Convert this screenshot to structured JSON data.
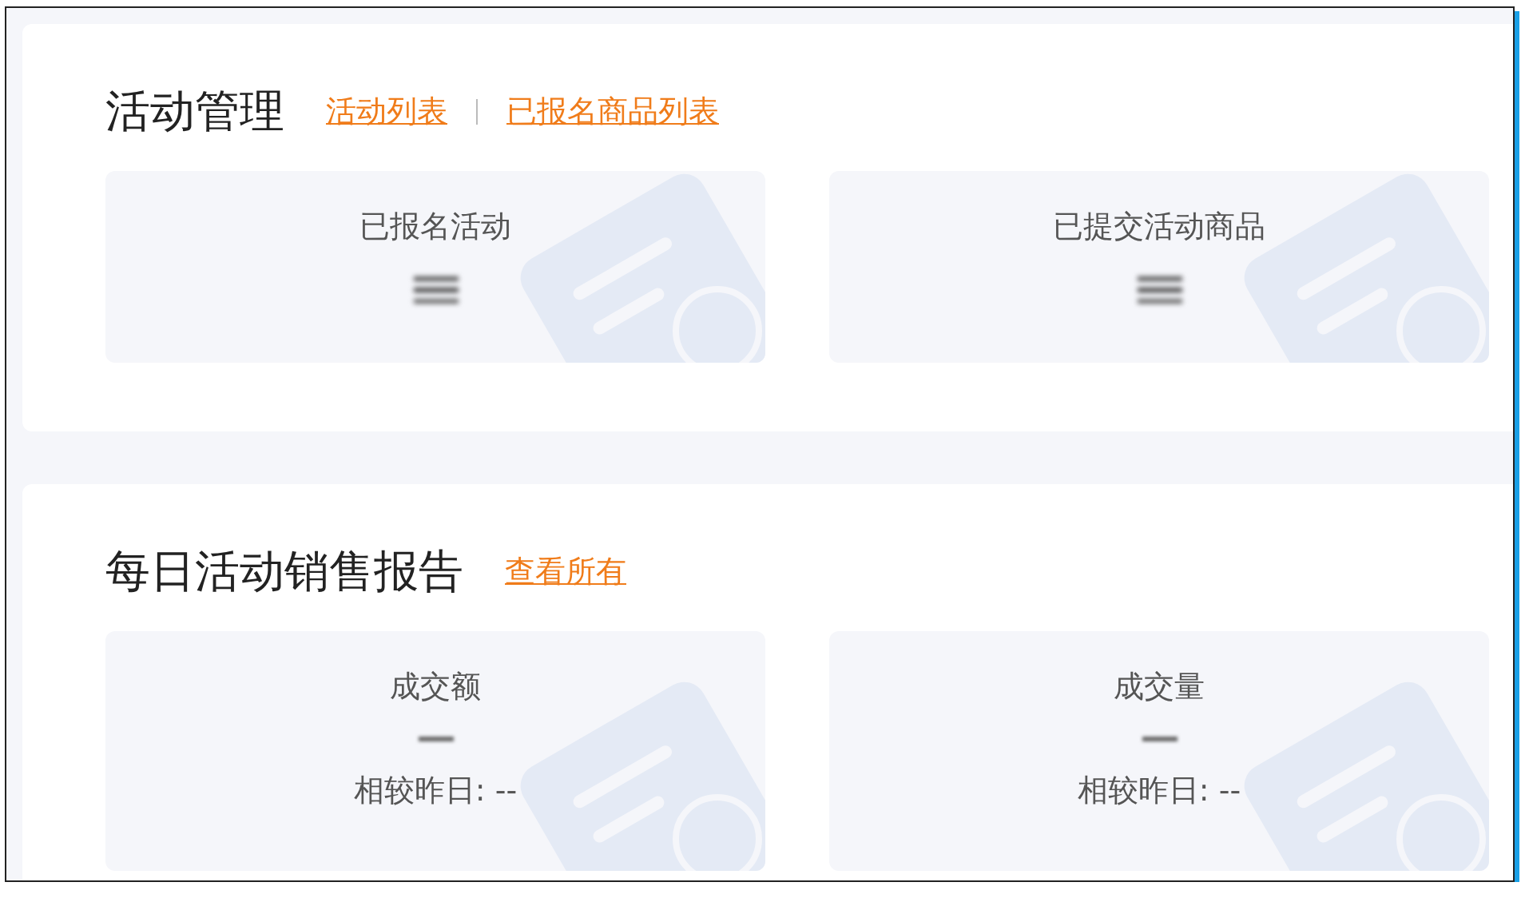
{
  "sections": [
    {
      "title": "活动管理",
      "links": [
        "活动列表",
        "已报名商品列表"
      ],
      "cards": [
        {
          "label": "已报名活动",
          "kind": "loading"
        },
        {
          "label": "已提交活动商品",
          "kind": "loading"
        }
      ]
    },
    {
      "title": "每日活动销售报告",
      "links": [
        "查看所有"
      ],
      "cards": [
        {
          "label": "成交额",
          "kind": "dash",
          "comparison": "相较昨日: --"
        },
        {
          "label": "成交量",
          "kind": "dash",
          "comparison": "相较昨日: --"
        }
      ]
    }
  ]
}
